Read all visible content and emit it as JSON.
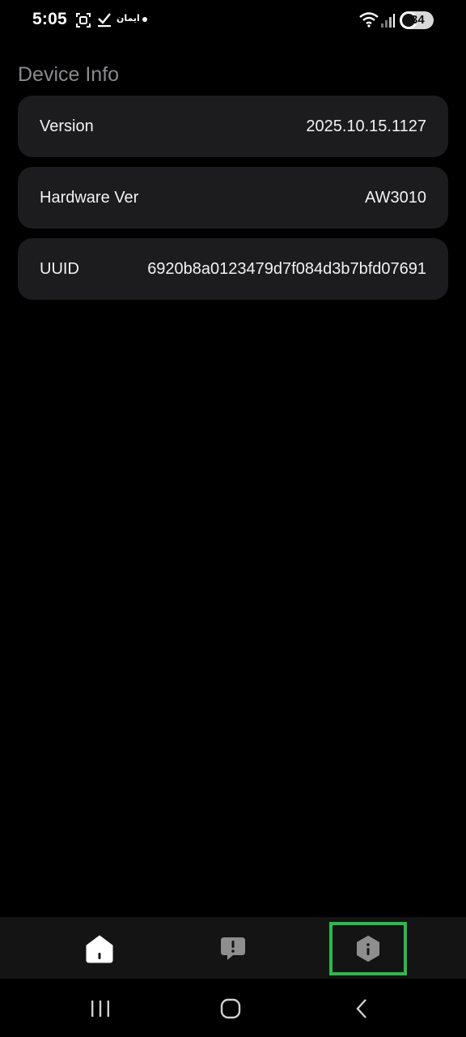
{
  "status_bar": {
    "time": "5:05",
    "notification_label": "ايمان",
    "battery_level": "34",
    "icons": [
      "screenshot-icon",
      "check-icon",
      "dot-icon",
      "wifi-icon",
      "signal-icon",
      "battery-icon"
    ]
  },
  "device_info": {
    "title": "Device Info",
    "rows": [
      {
        "label": "Version",
        "value": "2025.10.15.1127"
      },
      {
        "label": "Hardware Ver",
        "value": "AW3010"
      },
      {
        "label": "UUID",
        "value": "6920b8a0123479d7f084d3b7bfd07691"
      }
    ]
  },
  "tab_bar": {
    "tabs": [
      {
        "name": "home",
        "icon": "home-icon",
        "selected": false
      },
      {
        "name": "alerts",
        "icon": "alert-bubble-icon",
        "selected": false
      },
      {
        "name": "device",
        "icon": "hexagon-info-icon",
        "selected": true
      }
    ],
    "highlight_color": "#2db94d"
  },
  "nav_bar": {
    "buttons": [
      "recent-apps-icon",
      "home-circle-icon",
      "back-chevron-icon"
    ]
  }
}
